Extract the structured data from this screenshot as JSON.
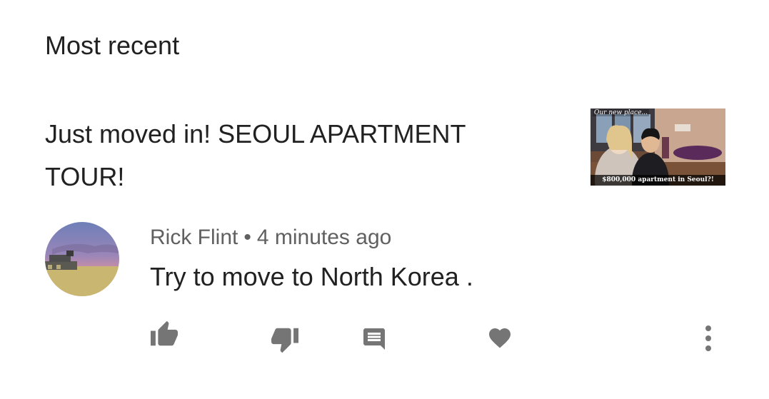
{
  "sort": {
    "label": "Most recent"
  },
  "video": {
    "title": "Just moved in! SEOUL APARTMENT TOUR!",
    "thumbnail": {
      "top_caption": "Our new place...",
      "bottom_caption": "$800,000 apartment in Seoul?!"
    }
  },
  "comment": {
    "author": "Rick Flint",
    "separator": "•",
    "timestamp": "4 minutes ago",
    "text": "Try to move to North Korea ."
  },
  "actions": {
    "icons": [
      "thumb-up-icon",
      "thumb-down-icon",
      "reply-icon",
      "heart-icon",
      "more-vert-icon"
    ],
    "icon_color": "#757575"
  },
  "colors": {
    "primary_text": "#212121",
    "secondary_text": "#606060",
    "background": "#ffffff"
  }
}
